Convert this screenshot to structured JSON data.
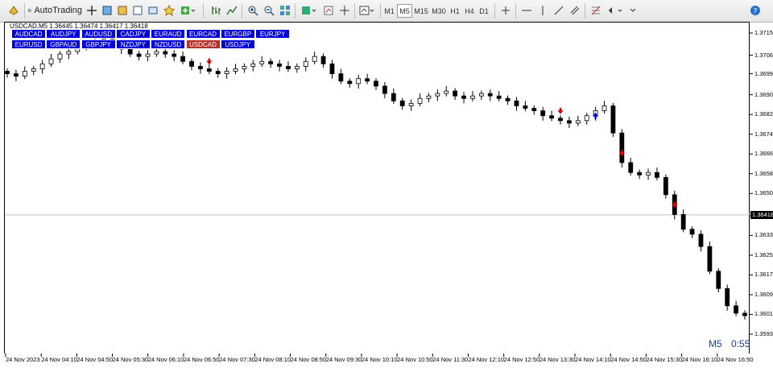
{
  "toolbar": {
    "autotrading_label": "AutoTrading",
    "timeframes": [
      "M1",
      "M5",
      "M15",
      "M30",
      "H1",
      "H4",
      "D1"
    ],
    "active_timeframe": "M5"
  },
  "chart": {
    "info": "USDCAD,M5  1.36445 1.36474 1.36417 1.36418",
    "current_price": "1.36418",
    "timeframe_badge": "M5",
    "countdown": "0:55",
    "symbol_buttons_row1": [
      "AUDCAD",
      "AUDJPY",
      "AUDUSD",
      "CADJPY",
      "EURAUD",
      "EURCAD",
      "EURGBP",
      "EURJPY"
    ],
    "symbol_buttons_row2": [
      "EURUSD",
      "GBPAUD",
      "GBPJPY",
      "NZDJPY",
      "NZDUSD",
      "USDCAD",
      "USDJPY"
    ],
    "selected_symbol": "USDCAD",
    "colors": {
      "button_bg": "#0000dd",
      "button_selected": "#b5322a",
      "arrow_down": "#dd0000",
      "arrow_up": "#0000dd"
    }
  },
  "chart_data": {
    "type": "candlestick",
    "symbol": "USDCAD",
    "timeframe": "M5",
    "y_ticks": [
      "1.37155",
      "1.37065",
      "1.36990",
      "1.36905",
      "1.36825",
      "1.36745",
      "1.36665",
      "1.36585",
      "1.36505",
      "1.36415",
      "1.36335",
      "1.36255",
      "1.36175",
      "1.36095",
      "1.36015",
      "1.35935"
    ],
    "y_tick_values": [
      1.37155,
      1.37065,
      1.3699,
      1.36905,
      1.36825,
      1.36745,
      1.36665,
      1.36585,
      1.36505,
      1.36415,
      1.36335,
      1.36255,
      1.36175,
      1.36095,
      1.36015,
      1.35935
    ],
    "x_labels": [
      "24 Nov 2023",
      "24 Nov 04:10",
      "24 Nov 04:50",
      "24 Nov 05:30",
      "24 Nov 06:10",
      "24 Nov 06:50",
      "24 Nov 07:30",
      "24 Nov 08:10",
      "24 Nov 08:50",
      "24 Nov 09:30",
      "24 Nov 10:10",
      "24 Nov 10:50",
      "24 Nov 11:30",
      "24 Nov 12:10",
      "24 Nov 12:50",
      "24 Nov 13:30",
      "24 Nov 14:10",
      "24 Nov 14:50",
      "24 Nov 15:30",
      "24 Nov 16:10",
      "24 Nov 16:50"
    ],
    "close_levels": [
      1.3699,
      1.3698,
      1.37,
      1.3701,
      1.3703,
      1.3705,
      1.3707,
      1.3708,
      1.371,
      1.3711,
      1.3712,
      1.3713,
      1.3711,
      1.3709,
      1.3707,
      1.3706,
      1.3707,
      1.3708,
      1.3707,
      1.3706,
      1.3704,
      1.3702,
      1.3701,
      1.37,
      1.3699,
      1.37,
      1.3701,
      1.3702,
      1.3703,
      1.3704,
      1.3703,
      1.3702,
      1.3701,
      1.3702,
      1.3704,
      1.3706,
      1.3703,
      1.3699,
      1.3696,
      1.3695,
      1.3697,
      1.3696,
      1.3694,
      1.3691,
      1.3688,
      1.3686,
      1.3687,
      1.3689,
      1.369,
      1.3691,
      1.3692,
      1.369,
      1.3689,
      1.369,
      1.3691,
      1.369,
      1.3689,
      1.3688,
      1.3686,
      1.3685,
      1.3684,
      1.3682,
      1.3681,
      1.368,
      1.3679,
      1.368,
      1.3682,
      1.3684,
      1.3686,
      1.3675,
      1.3663,
      1.3659,
      1.3658,
      1.3659,
      1.3657,
      1.365,
      1.3642,
      1.3636,
      1.3634,
      1.3629,
      1.3619,
      1.3612,
      1.3605,
      1.3602,
      1.3601
    ],
    "current_price": 1.36418,
    "signals": [
      {
        "type": "sell",
        "index": 23
      },
      {
        "type": "sell",
        "index": 63
      },
      {
        "type": "buy",
        "index": 67
      },
      {
        "type": "sell",
        "index": 70
      },
      {
        "type": "sell",
        "index": 76
      }
    ]
  }
}
